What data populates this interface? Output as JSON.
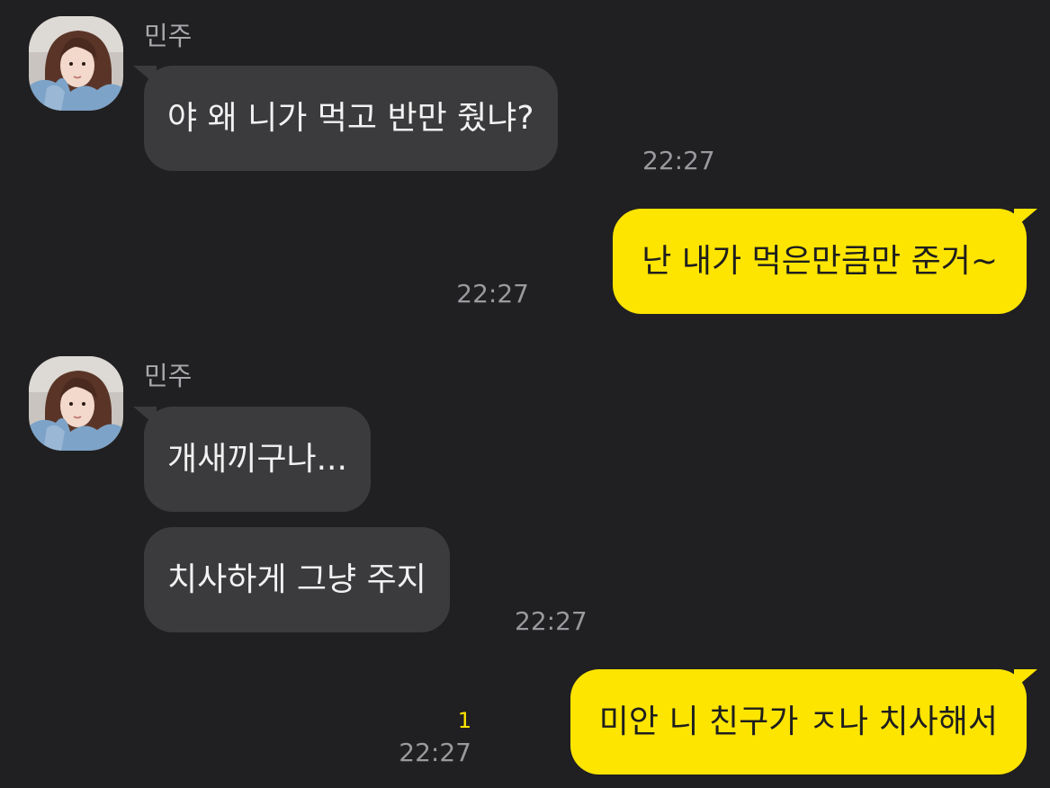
{
  "chat": {
    "sender_name": "민주",
    "colors": {
      "background": "#202022",
      "incoming_bubble": "#3b3b3d",
      "outgoing_bubble": "#fee500",
      "unread_count": "#fee500"
    },
    "messages": [
      {
        "direction": "incoming",
        "sender": "민주",
        "text": "야 왜 니가 먹고 반만 줬냐?",
        "time": "22:27"
      },
      {
        "direction": "outgoing",
        "text": "난 내가 먹은만큼만 준거~",
        "time": "22:27"
      },
      {
        "direction": "incoming",
        "sender": "민주",
        "text": "개새끼구나...",
        "time": ""
      },
      {
        "direction": "incoming",
        "text": "치사하게 그냥 주지",
        "time": "22:27"
      },
      {
        "direction": "outgoing",
        "text": "미안 니 친구가 ㅈ나 치사해서",
        "time": "22:27",
        "unread": "1"
      }
    ]
  }
}
